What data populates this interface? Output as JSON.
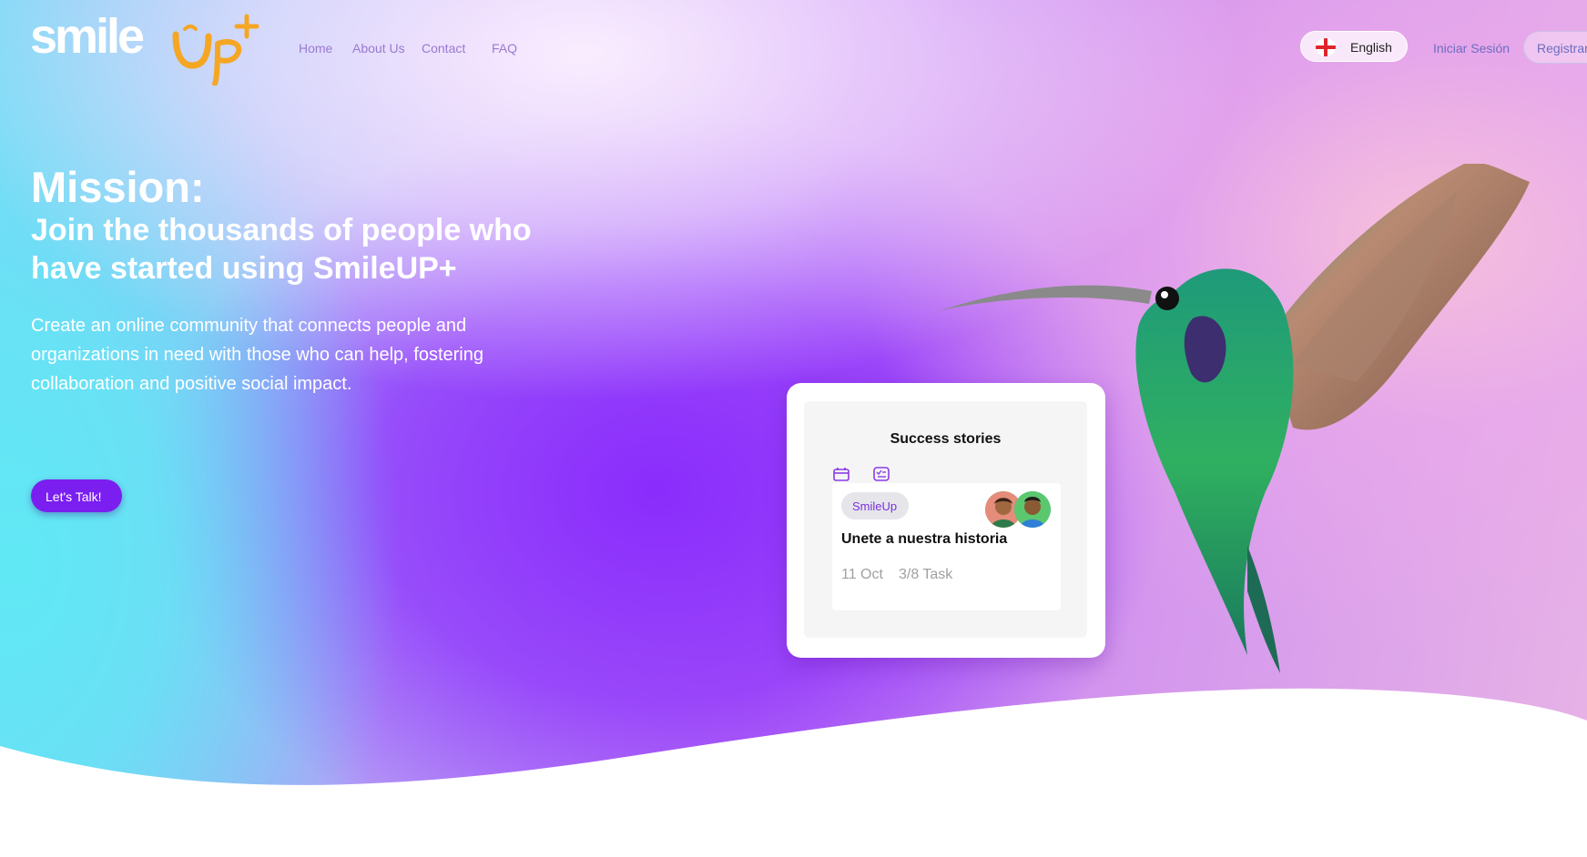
{
  "brand": {
    "logo_text": "smile",
    "logo_accent": "up+",
    "accent_color": "#f5a623"
  },
  "nav": {
    "items": [
      {
        "label": "Home"
      },
      {
        "label": "About Us"
      },
      {
        "label": "Contact"
      },
      {
        "label": "FAQ"
      }
    ]
  },
  "header": {
    "language": {
      "label": "English",
      "icon": "england-flag-icon"
    },
    "login_label": "Iniciar Sesión",
    "register_label": "Registrarse"
  },
  "hero": {
    "mission_title": "Mission:",
    "headline": "Join the thousands of people who have started using SmileUP+",
    "description": "Create an online community that connects people and organizations in need with those who can help, fostering collaboration and positive social impact.",
    "cta_label": "Let's Talk!"
  },
  "card": {
    "title": "Success stories",
    "icons": [
      "calendar-icon",
      "task-list-icon"
    ],
    "task": {
      "tag": "SmileUp",
      "title": "Unete a nuestra historia",
      "date": "11 Oct",
      "progress": "3/8 Task"
    }
  },
  "colors": {
    "primary": "#7a1ff0",
    "nav_text": "#9a79cf",
    "link_text": "#6d6dbf"
  }
}
